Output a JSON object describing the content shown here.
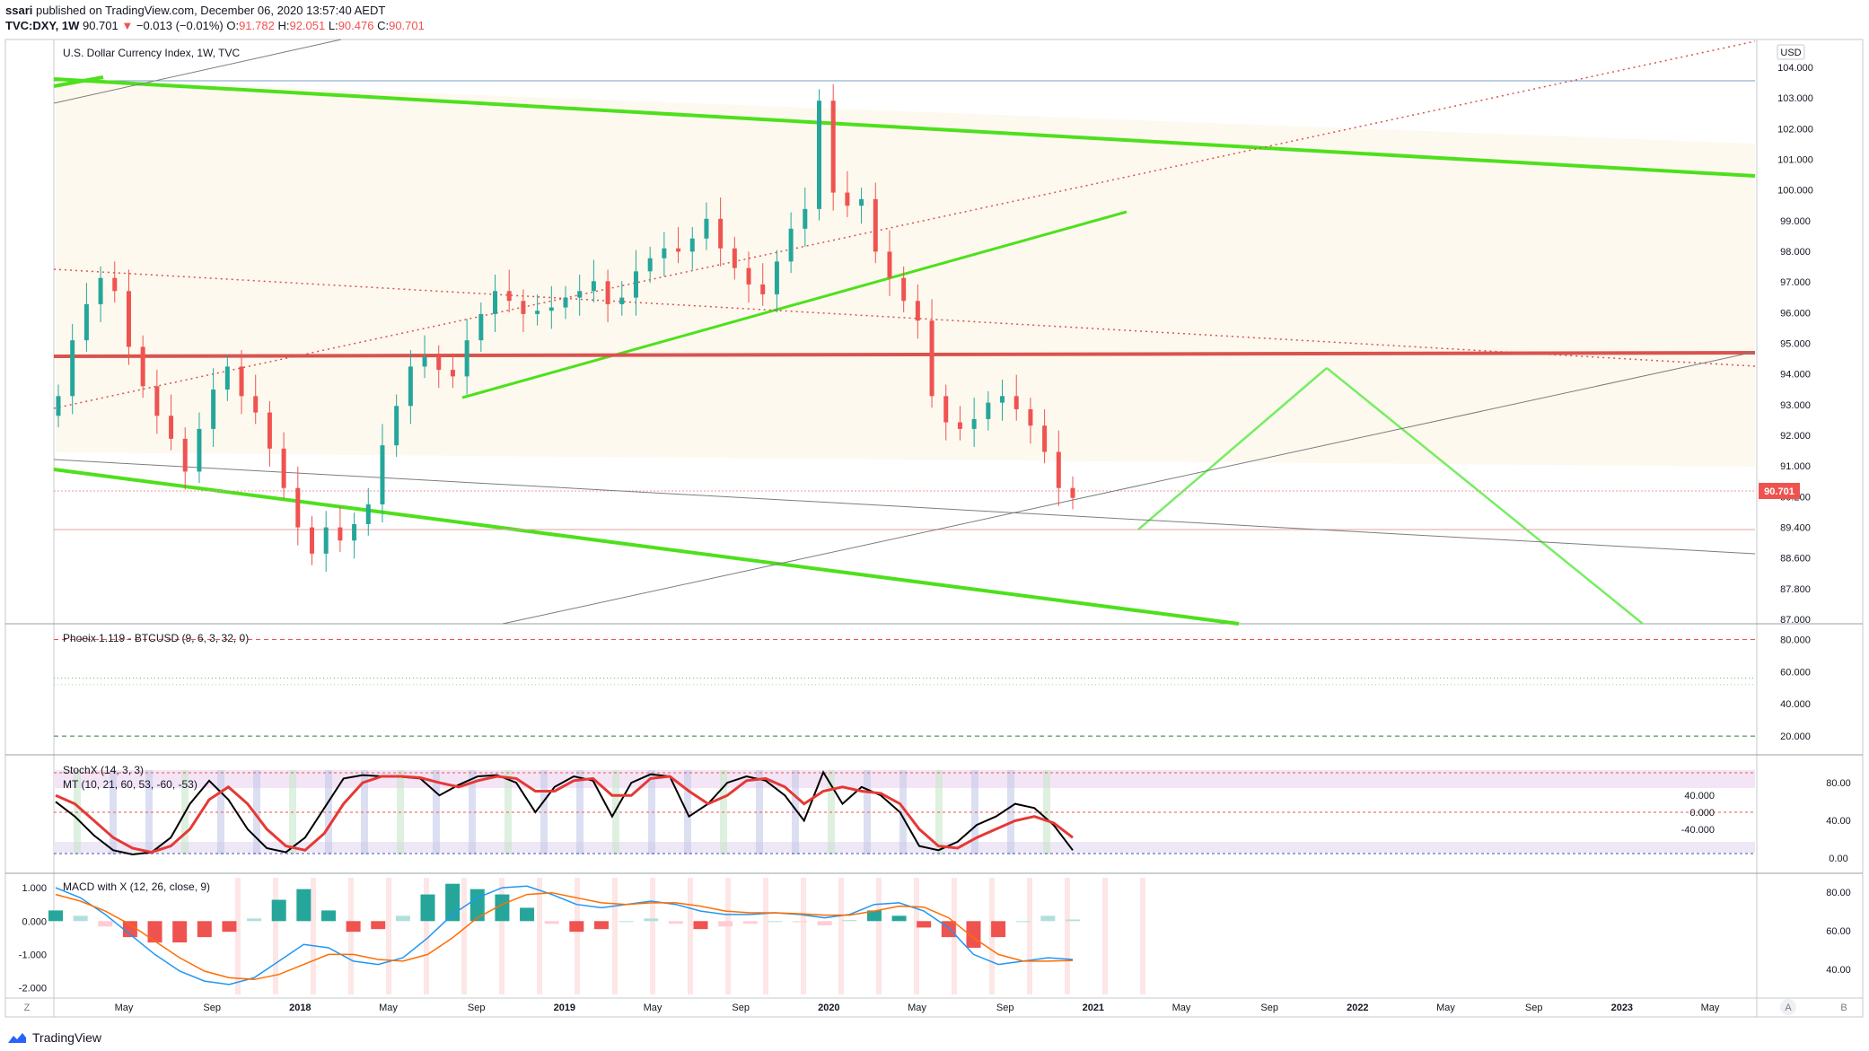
{
  "header": {
    "line1_user": "ssari",
    "line1_rest": " published on TradingView.com, December 06, 2020 13:57:40 AEDT",
    "symbol": "TVC:DXY, 1W",
    "last": "90.701",
    "change_arrow": "▼",
    "change": "−0.013 (−0.01%)",
    "o_label": "O:",
    "o_val": "91.782",
    "h_label": "H:",
    "h_val": "92.051",
    "l_label": "L:",
    "l_val": "90.476",
    "c_label": "C:",
    "c_val": "90.701"
  },
  "footer": {
    "brand": "TradingView"
  },
  "colors": {
    "up": "#26a69a",
    "down": "#ef5350",
    "trend_green": "#4ee01c",
    "light_green": "#76ee62",
    "channel_bg": "#fdf9ef",
    "resistance": "#d9534f",
    "macd": "#2196f3",
    "signal": "#ff6d00"
  },
  "chart_data": [
    {
      "type": "candlestick",
      "title": "U.S. Dollar Currency Index, 1W, TVC",
      "currency": "USD",
      "x_labels": [
        "May",
        "Sep",
        "2018",
        "May",
        "Sep",
        "2019",
        "May",
        "Sep",
        "2020",
        "May",
        "Sep",
        "2021",
        "May",
        "Sep",
        "2022",
        "May",
        "Sep",
        "2023",
        "May"
      ],
      "y_ticks": [
        "104.000",
        "103.000",
        "102.000",
        "101.000",
        "100.000",
        "99.000",
        "98.000",
        "97.000",
        "96.000",
        "95.000",
        "94.000",
        "93.000",
        "92.000",
        "91.000",
        "90.200",
        "89.400",
        "88.600",
        "87.800",
        "87.000"
      ],
      "last_price_label": "90.701",
      "ylim": [
        87.0,
        104.5
      ],
      "series": [
        {
          "name": "DXY",
          "close": [
            93.8,
            95.5,
            96.6,
            97.4,
            97.0,
            95.3,
            94.1,
            93.2,
            92.5,
            91.5,
            92.8,
            94.0,
            94.7,
            93.8,
            93.3,
            92.2,
            91.0,
            89.8,
            89.0,
            89.8,
            89.4,
            89.9,
            90.5,
            92.3,
            93.5,
            94.7,
            95.0,
            94.6,
            94.4,
            95.5,
            96.3,
            97.0,
            96.7,
            96.3,
            96.4,
            96.5,
            96.8,
            97.0,
            97.3,
            96.6,
            96.8,
            97.6,
            98.0,
            98.3,
            98.2,
            98.6,
            99.2,
            98.3,
            97.7,
            97.2,
            96.9,
            97.9,
            98.9,
            99.5,
            102.8,
            100.0,
            99.6,
            99.8,
            98.2,
            97.4,
            96.7,
            96.1,
            93.8,
            93.0,
            92.8,
            93.1,
            93.6,
            93.8,
            93.4,
            92.9,
            92.1,
            91.0,
            90.7
          ]
        }
      ]
    },
    {
      "type": "line",
      "title": "Phoeix 1.119 - BTCUSD (9, 6, 3, 32, 0)",
      "y_ticks": [
        "80.000",
        "60.000",
        "40.000",
        "20.000"
      ],
      "ylim": [
        10,
        87
      ]
    },
    {
      "type": "line",
      "title": "StochX (14, 3, 3)",
      "subtitle": "MT (10, 21, 60, 53, -60, -53)",
      "y_ticks_left": [
        "40.000",
        "0.000",
        "-40.000"
      ],
      "y_ticks_right": [
        "80.00",
        "40.00",
        "0.00"
      ],
      "ylim": [
        -100,
        100
      ],
      "series": [
        {
          "name": "stoch",
          "values": [
            25,
            -10,
            -55,
            -90,
            -100,
            -95,
            -60,
            20,
            75,
            30,
            -40,
            -85,
            -95,
            -60,
            10,
            80,
            88,
            85,
            84,
            80,
            40,
            65,
            85,
            88,
            70,
            0,
            60,
            85,
            75,
            -10,
            70,
            90,
            85,
            -10,
            20,
            70,
            85,
            75,
            40,
            -20,
            95,
            20,
            60,
            40,
            0,
            -80,
            -90,
            -70,
            -30,
            -10,
            20,
            10,
            -30,
            -90
          ]
        },
        {
          "name": "signal",
          "values": [
            40,
            20,
            -20,
            -60,
            -85,
            -95,
            -80,
            -40,
            30,
            60,
            20,
            -40,
            -80,
            -90,
            -50,
            20,
            70,
            85,
            85,
            82,
            70,
            60,
            75,
            85,
            80,
            50,
            50,
            75,
            80,
            40,
            40,
            80,
            85,
            50,
            20,
            40,
            75,
            80,
            60,
            20,
            50,
            60,
            50,
            45,
            20,
            -40,
            -80,
            -85,
            -60,
            -40,
            -20,
            -10,
            -25,
            -60
          ]
        }
      ]
    },
    {
      "type": "bar",
      "title": "MACD with X (12, 26, close, 9)",
      "y_ticks_left": [
        "1.000",
        "0.000",
        "-1.000",
        "-2.000"
      ],
      "y_ticks_right": [
        "80.00",
        "60.00",
        "40.00"
      ],
      "ylim": [
        -2.2,
        1.3
      ],
      "series": [
        {
          "name": "macd",
          "values": [
            1.0,
            0.7,
            0.2,
            -0.4,
            -1.0,
            -1.5,
            -1.8,
            -1.9,
            -1.7,
            -1.2,
            -0.7,
            -0.8,
            -1.2,
            -1.3,
            -1.1,
            -0.5,
            0.2,
            0.7,
            1.0,
            1.05,
            0.8,
            0.5,
            0.4,
            0.5,
            0.6,
            0.5,
            0.3,
            0.2,
            0.2,
            0.25,
            0.2,
            0.1,
            0.2,
            0.5,
            0.55,
            0.3,
            -0.2,
            -1.0,
            -1.3,
            -1.2,
            -1.1,
            -1.15
          ]
        },
        {
          "name": "signal",
          "values": [
            0.8,
            0.6,
            0.3,
            -0.1,
            -0.6,
            -1.1,
            -1.5,
            -1.7,
            -1.75,
            -1.6,
            -1.3,
            -1.0,
            -1.0,
            -1.15,
            -1.2,
            -1.0,
            -0.5,
            0.1,
            0.5,
            0.8,
            0.85,
            0.7,
            0.55,
            0.5,
            0.55,
            0.55,
            0.45,
            0.3,
            0.25,
            0.25,
            0.22,
            0.18,
            0.18,
            0.3,
            0.45,
            0.42,
            0.1,
            -0.5,
            -1.0,
            -1.2,
            -1.2,
            -1.18
          ]
        }
      ]
    }
  ]
}
